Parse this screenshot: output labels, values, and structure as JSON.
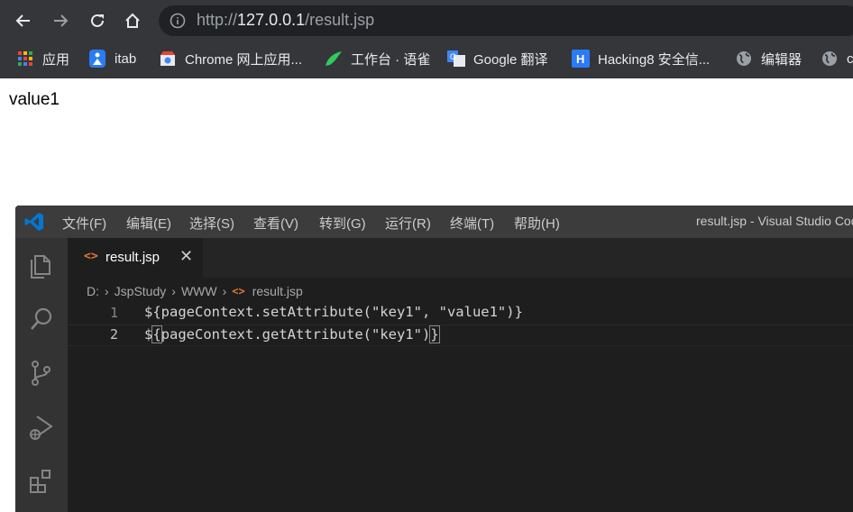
{
  "browser": {
    "url_scheme": "http://",
    "url_host": "127.0.0.1",
    "url_path": "/result.jsp",
    "bookmarks": [
      {
        "label": "应用",
        "icon": "apps-grid-icon"
      },
      {
        "label": "itab",
        "icon": "itab-icon"
      },
      {
        "label": "Chrome 网上应用...",
        "icon": "chrome-webstore-icon"
      },
      {
        "label": "工作台 · 语雀",
        "icon": "yuque-icon"
      },
      {
        "label": "Google 翻译",
        "icon": "google-translate-icon"
      },
      {
        "label": "Hacking8 安全信...",
        "icon": "hacking8-icon"
      },
      {
        "label": "编辑器",
        "icon": "globe-icon"
      },
      {
        "label": "c",
        "icon": "globe-icon"
      }
    ]
  },
  "page": {
    "output_text": "value1"
  },
  "vscode": {
    "menu": [
      "文件(F)",
      "编辑(E)",
      "选择(S)",
      "查看(V)",
      "转到(G)",
      "运行(R)",
      "终端(T)",
      "帮助(H)"
    ],
    "window_title": "result.jsp - Visual Studio Code",
    "tab": {
      "label": "result.jsp",
      "icon_text": "<>",
      "close": "✕"
    },
    "breadcrumb": [
      "D:",
      "JspStudy",
      "WWW",
      "result.jsp"
    ],
    "lines": [
      {
        "number": "1",
        "text": "${pageContext.setAttribute(\"key1\", \"value1\")}"
      },
      {
        "number": "2",
        "prefix": "$",
        "open": "{",
        "middle": "pageContext.getAttribute(\"key1\")",
        "close": "}"
      }
    ],
    "accent_color": "#0078d4"
  }
}
